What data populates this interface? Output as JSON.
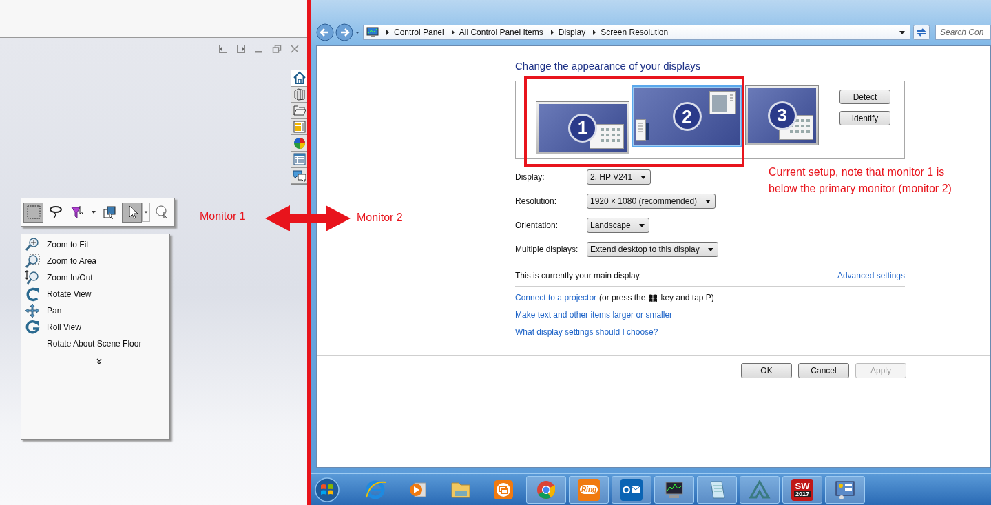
{
  "cad_window": {
    "window_controls": [
      {
        "kind": "dock-left"
      },
      {
        "kind": "dock-right"
      },
      {
        "kind": "minimize"
      },
      {
        "kind": "restore"
      },
      {
        "kind": "close"
      }
    ],
    "task_pane_tabs": [
      {
        "kind": "home"
      },
      {
        "kind": "parts"
      },
      {
        "kind": "folder"
      },
      {
        "kind": "layout"
      },
      {
        "kind": "appearance"
      },
      {
        "kind": "list"
      },
      {
        "kind": "forum"
      }
    ],
    "selection_toolbar": [
      {
        "kind": "box-select",
        "selected": true
      },
      {
        "kind": "lasso",
        "selected": false
      },
      {
        "kind": "filter",
        "selected": false
      },
      {
        "kind": "stack",
        "selected": false
      },
      {
        "kind": "pointer",
        "selected": true
      },
      {
        "kind": "magnify",
        "selected": false
      }
    ],
    "view_menu": [
      {
        "kind": "zoom-fit",
        "label": "Zoom to Fit"
      },
      {
        "kind": "zoom-area",
        "label": "Zoom to Area"
      },
      {
        "kind": "zoom-inout",
        "label": "Zoom In/Out"
      },
      {
        "kind": "rotate",
        "label": "Rotate View"
      },
      {
        "kind": "pan",
        "label": "Pan"
      },
      {
        "kind": "roll",
        "label": "Roll View"
      },
      {
        "kind": "plain",
        "label": "Rotate About Scene Floor"
      }
    ]
  },
  "explorer": {
    "breadcrumb": [
      "Control Panel",
      "All Control Panel Items",
      "Display",
      "Screen Resolution"
    ],
    "search": {
      "placeholder": "Search Con"
    }
  },
  "screen_resolution": {
    "heading": "Change the appearance of your displays",
    "monitors": [
      {
        "number": "1",
        "selected": false
      },
      {
        "number": "2",
        "selected": true
      },
      {
        "number": "3",
        "selected": false
      }
    ],
    "side_buttons": [
      "Detect",
      "Identify"
    ],
    "settings": [
      {
        "label": "Display:",
        "value": "2. HP V241"
      },
      {
        "label": "Resolution:",
        "value": "1920 × 1080 (recommended)"
      },
      {
        "label": "Orientation:",
        "value": "Landscape"
      },
      {
        "label": "Multiple displays:",
        "value": "Extend desktop to this display"
      }
    ],
    "status_text": "This is currently your main display.",
    "advanced_link": "Advanced settings",
    "projector_line": {
      "link": "Connect to a projector",
      "before_key": "(or press the",
      "after_key": "key and tap P)"
    },
    "links": [
      "Make text and other items larger or smaller",
      "What display settings should I choose?"
    ],
    "buttons": [
      {
        "label": "OK",
        "disabled": false
      },
      {
        "label": "Cancel",
        "disabled": false
      },
      {
        "label": "Apply",
        "disabled": true
      }
    ]
  },
  "taskbar": [
    {
      "kind": "ie",
      "running": false
    },
    {
      "kind": "media",
      "running": false
    },
    {
      "kind": "explorer",
      "running": false
    },
    {
      "kind": "chat",
      "running": false
    },
    {
      "kind": "chrome",
      "running": true
    },
    {
      "kind": "ring",
      "running": true,
      "label": "Ring"
    },
    {
      "kind": "outlook",
      "running": true,
      "label": "O"
    },
    {
      "kind": "monitor",
      "running": true
    },
    {
      "kind": "notepad",
      "running": true
    },
    {
      "kind": "peak",
      "running": true
    },
    {
      "kind": "sw",
      "running": true,
      "label": "SW",
      "badge": "2017"
    },
    {
      "kind": "control-panel",
      "running": true
    }
  ],
  "annotations": {
    "left_label": "Monitor 1",
    "right_label": "Monitor 2",
    "note": "Current setup, note that monitor 1 is below the primary monitor (monitor 2)"
  }
}
